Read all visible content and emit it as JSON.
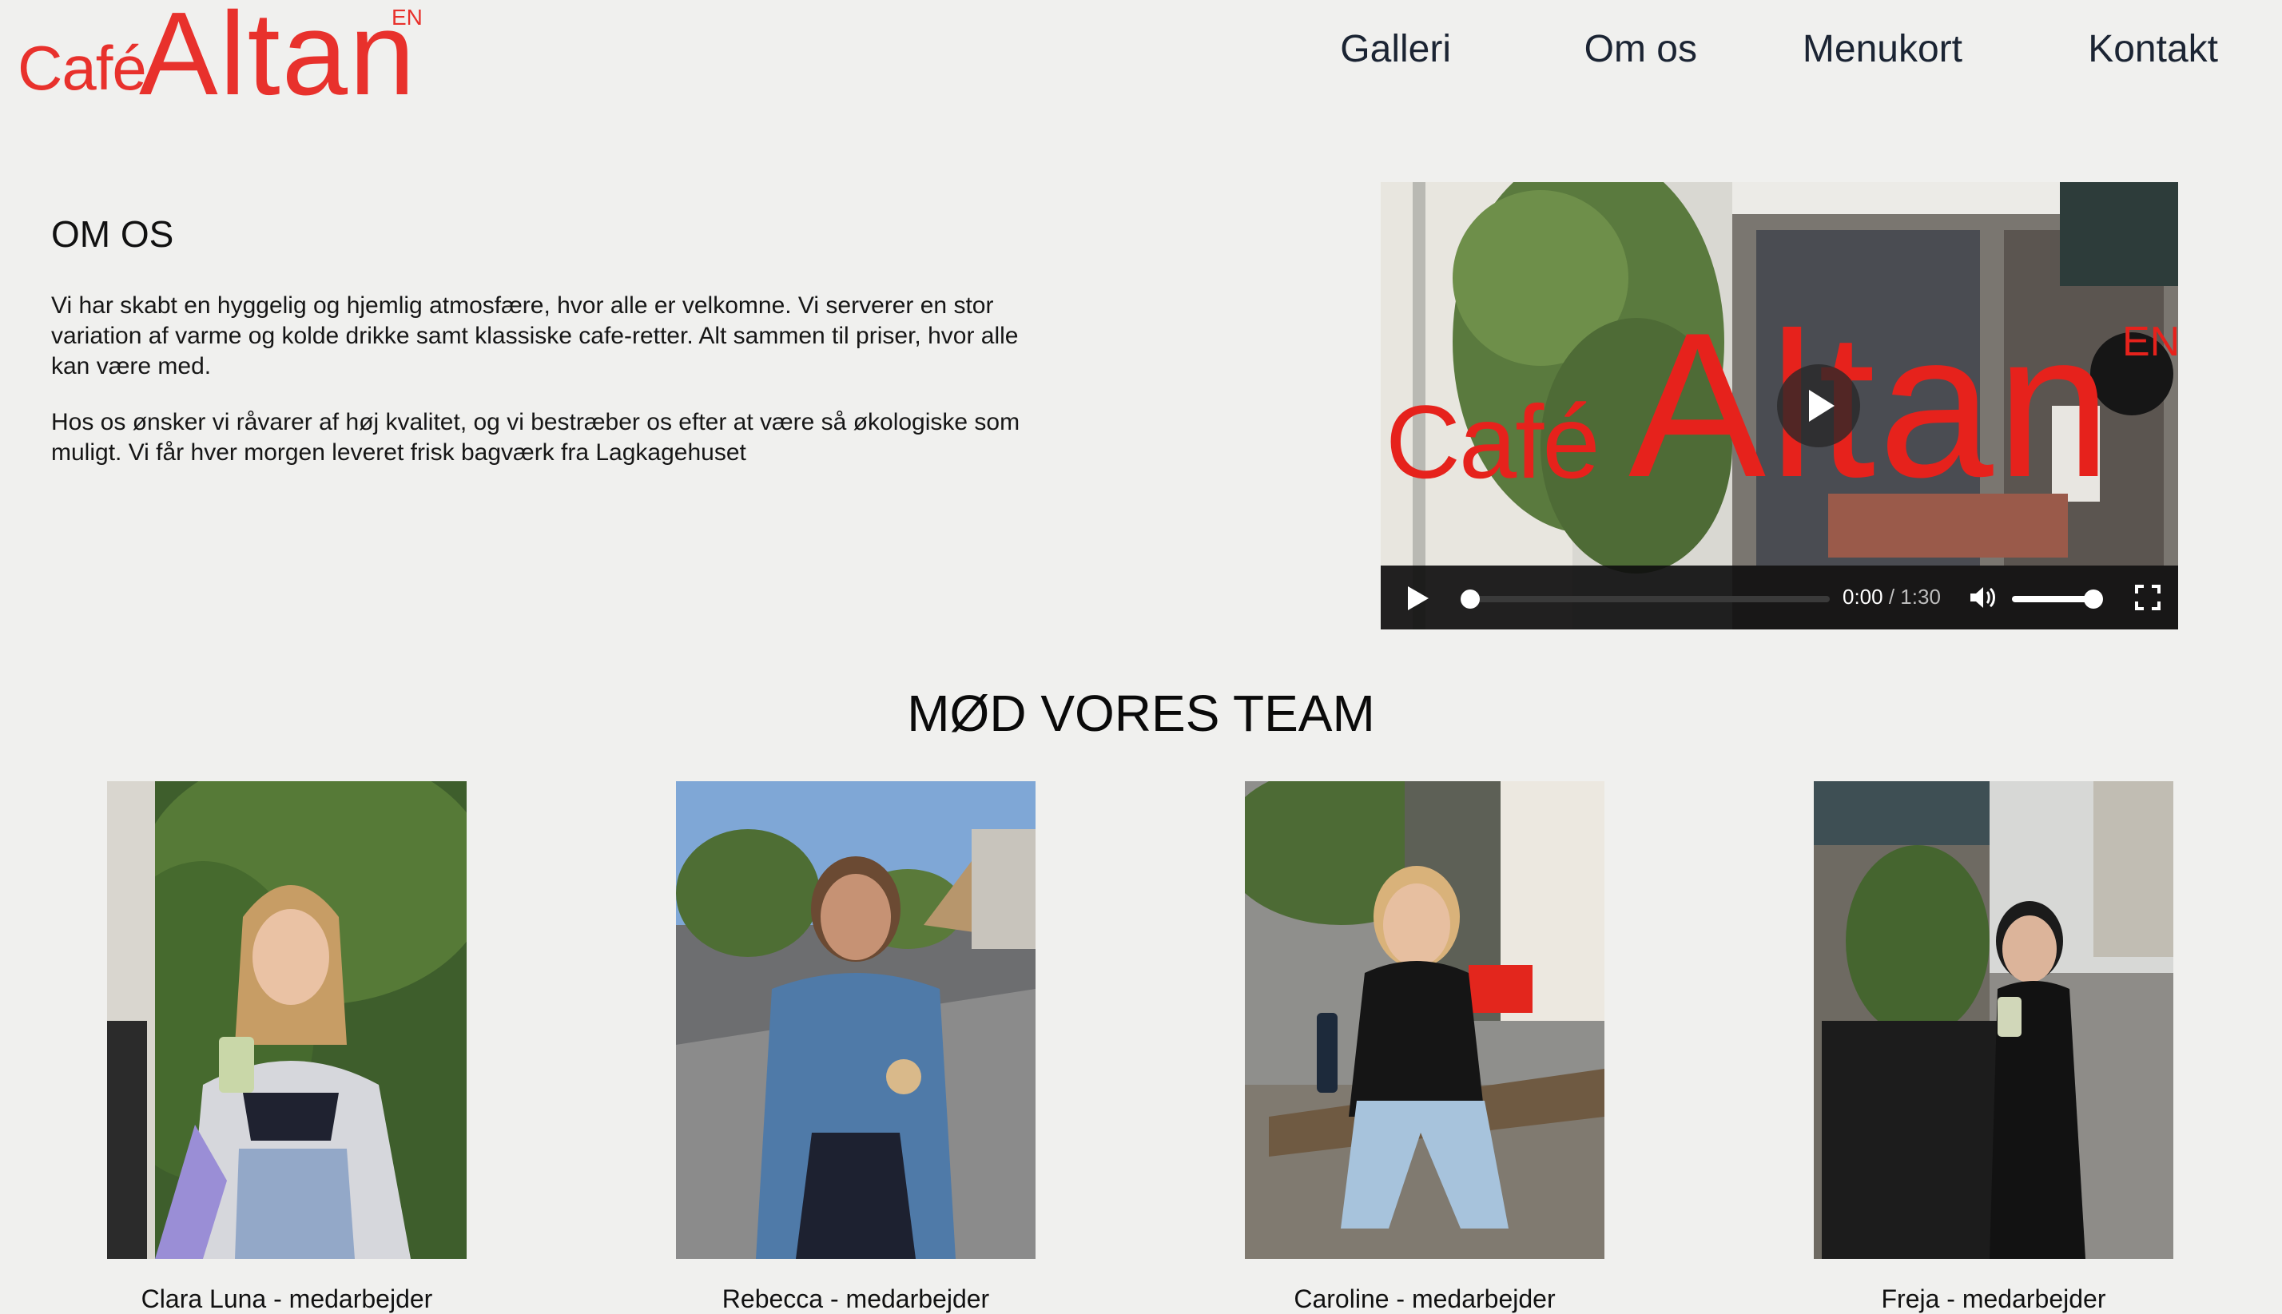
{
  "header": {
    "logo": {
      "cafe": "Café",
      "altan": "Altan",
      "lang": "EN"
    },
    "nav": [
      "Galleri",
      "Om os",
      "Menukort",
      "Kontakt"
    ]
  },
  "about": {
    "title": "OM OS",
    "paragraphs": [
      "Vi har skabt en hyggelig og hjemlig atmosfære, hvor alle er velkomne. Vi serverer en stor variation af varme og kolde drikke samt klassiske cafe-retter. Alt sammen til priser, hvor alle kan være med.",
      "Hos os ønsker vi råvarer af høj kvalitet, og vi bestræber os efter at være så økologiske som muligt. Vi får hver morgen leveret frisk bagværk fra Lagkagehuset"
    ]
  },
  "video": {
    "overlay_brand": {
      "cafe": "Café",
      "altan": "Altan",
      "lang": "EN"
    },
    "current_time": "0:00",
    "duration": "1:30",
    "progress": 0,
    "volume": 0.9
  },
  "team": {
    "title": "MØD VORES TEAM",
    "members": [
      {
        "caption": "Clara Luna - medarbejder"
      },
      {
        "caption": "Rebecca - medarbejder"
      },
      {
        "caption": "Caroline - medarbejder"
      },
      {
        "caption": "Freja - medarbejder"
      }
    ]
  },
  "colors": {
    "brand": "#e8312c",
    "background": "#f0f0ee",
    "nav_text": "#1b2433"
  }
}
